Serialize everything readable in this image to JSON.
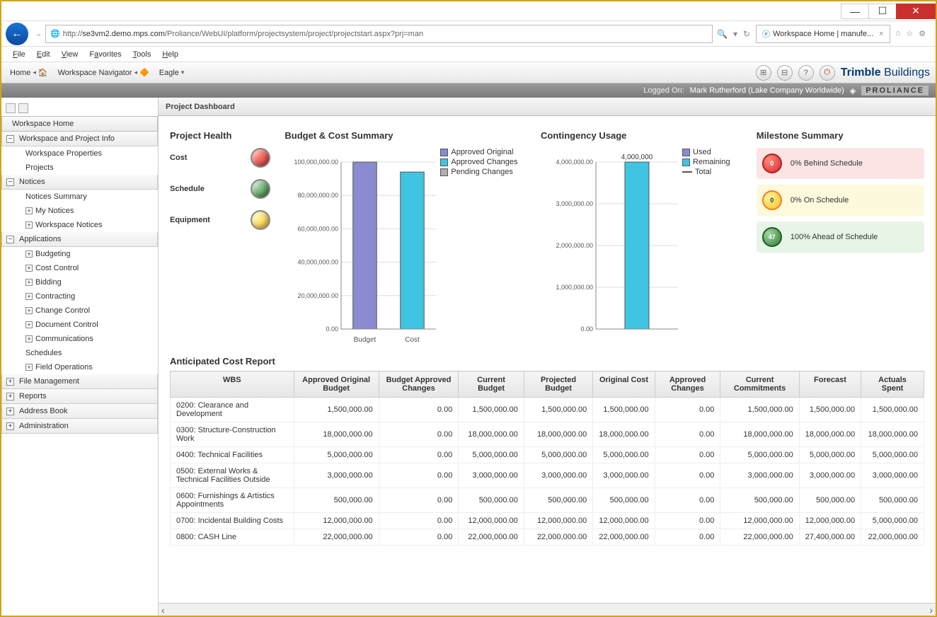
{
  "browser": {
    "url_prefix": "http://",
    "url_host": "se3vm2.demo.mps.com",
    "url_path": "/Proliance/WebUI/platform/projectsystem/project/projectstart.aspx?prj=man",
    "tab_title": "Workspace Home | manufe...",
    "menu": [
      "File",
      "Edit",
      "View",
      "Favorites",
      "Tools",
      "Help"
    ]
  },
  "toolbar": {
    "crumbs": [
      "Home",
      "Workspace Navigator",
      "Eagle"
    ],
    "brand_main": "Trimble",
    "brand_sub": "Buildings"
  },
  "logged": {
    "label": "Logged On:",
    "user": "Mark Rutherford (Lake Company Worldwide)",
    "product": "PROLIANCE"
  },
  "sidebar": {
    "home": "Workspace Home",
    "sections": [
      {
        "label": "Workspace and Project Info",
        "items": [
          {
            "label": "Workspace Properties"
          },
          {
            "label": "Projects"
          }
        ]
      },
      {
        "label": "Notices",
        "items": [
          {
            "label": "Notices Summary"
          },
          {
            "label": "My Notices",
            "expand": true
          },
          {
            "label": "Workspace Notices",
            "expand": true
          }
        ]
      },
      {
        "label": "Applications",
        "items": [
          {
            "label": "Budgeting",
            "expand": true
          },
          {
            "label": "Cost Control",
            "expand": true
          },
          {
            "label": "Bidding",
            "expand": true
          },
          {
            "label": "Contracting",
            "expand": true
          },
          {
            "label": "Change Control",
            "expand": true
          },
          {
            "label": "Document Control",
            "expand": true
          },
          {
            "label": "Communications",
            "expand": true
          },
          {
            "label": "Schedules"
          },
          {
            "label": "Field Operations",
            "expand": true
          }
        ]
      },
      {
        "label": "File Management",
        "collapsed": true
      },
      {
        "label": "Reports",
        "collapsed": true
      },
      {
        "label": "Address Book",
        "collapsed": true
      },
      {
        "label": "Administration",
        "collapsed": true
      }
    ]
  },
  "dashboard": {
    "title": "Project Dashboard",
    "health": {
      "title": "Project Health",
      "rows": [
        {
          "label": "Cost",
          "color": "red"
        },
        {
          "label": "Schedule",
          "color": "green"
        },
        {
          "label": "Equipment",
          "color": "yellow"
        }
      ]
    },
    "budget_chart_title": "Budget & Cost Summary",
    "contingency_chart_title": "Contingency Usage",
    "milestone": {
      "title": "Milestone Summary",
      "items": [
        {
          "count": "0",
          "label": "0% Behind Schedule",
          "color": "red"
        },
        {
          "count": "0",
          "label": "0% On Schedule",
          "color": "yellow"
        },
        {
          "count": "47",
          "label": "100% Ahead of Schedule",
          "color": "green"
        }
      ]
    },
    "report": {
      "title": "Anticipated Cost Report",
      "headers": [
        "WBS",
        "Approved Original Budget",
        "Budget Approved Changes",
        "Current Budget",
        "Projected Budget",
        "Original Cost",
        "Approved Changes",
        "Current Commitments",
        "Forecast",
        "Actuals Spent"
      ],
      "rows": [
        [
          "0200: Clearance and Development",
          "1,500,000.00",
          "0.00",
          "1,500,000.00",
          "1,500,000.00",
          "1,500,000.00",
          "0.00",
          "1,500,000.00",
          "1,500,000.00",
          "1,500,000.00"
        ],
        [
          "0300: Structure-Construction Work",
          "18,000,000.00",
          "0.00",
          "18,000,000.00",
          "18,000,000.00",
          "18,000,000.00",
          "0.00",
          "18,000,000.00",
          "18,000,000.00",
          "18,000,000.00"
        ],
        [
          "0400: Technical Facilities",
          "5,000,000.00",
          "0.00",
          "5,000,000.00",
          "5,000,000.00",
          "5,000,000.00",
          "0.00",
          "5,000,000.00",
          "5,000,000.00",
          "5,000,000.00"
        ],
        [
          "0500: External Works & Technical Facilities Outside",
          "3,000,000.00",
          "0.00",
          "3,000,000.00",
          "3,000,000.00",
          "3,000,000.00",
          "0.00",
          "3,000,000.00",
          "3,000,000.00",
          "3,000,000.00"
        ],
        [
          "0600: Furnishings & Artistics Appointments",
          "500,000.00",
          "0.00",
          "500,000.00",
          "500,000.00",
          "500,000.00",
          "0.00",
          "500,000.00",
          "500,000.00",
          "500,000.00"
        ],
        [
          "0700: Incidental Building Costs",
          "12,000,000.00",
          "0.00",
          "12,000,000.00",
          "12,000,000.00",
          "12,000,000.00",
          "0.00",
          "12,000,000.00",
          "12,000,000.00",
          "5,000,000.00"
        ],
        [
          "0800: CASH Line",
          "22,000,000.00",
          "0.00",
          "22,000,000.00",
          "22,000,000.00",
          "22,000,000.00",
          "0.00",
          "22,000,000.00",
          "27,400,000.00",
          "22,000,000.00"
        ]
      ]
    }
  },
  "chart_data": [
    {
      "type": "bar",
      "title": "Budget & Cost Summary",
      "categories": [
        "Budget",
        "Cost"
      ],
      "values": [
        100000000,
        94000000
      ],
      "ylim": [
        0,
        100000000
      ],
      "ytick_labels": [
        "0.00",
        "20,000,000.00",
        "40,000,000.00",
        "60,000,000.00",
        "80,000,000.00",
        "100,000,000.00"
      ],
      "legend": [
        "Approved Original",
        "Approved Changes",
        "Pending Changes"
      ],
      "colors": [
        "#8a8bd0",
        "#3fc5e2",
        "#b0b0b0"
      ]
    },
    {
      "type": "bar",
      "title": "Contingency Usage",
      "categories": [
        ""
      ],
      "series": [
        {
          "name": "Remaining",
          "values": [
            4000000
          ]
        }
      ],
      "total_label": "4,000,000",
      "ylim": [
        0,
        4000000
      ],
      "ytick_labels": [
        "0.00",
        "1,000,000.00",
        "2,000,000.00",
        "3,000,000.00",
        "4,000,000.00"
      ],
      "legend": [
        "Used",
        "Remaining",
        "Total"
      ],
      "colors": [
        "#8a8bd0",
        "#3fc5e2",
        "#555555"
      ]
    }
  ]
}
